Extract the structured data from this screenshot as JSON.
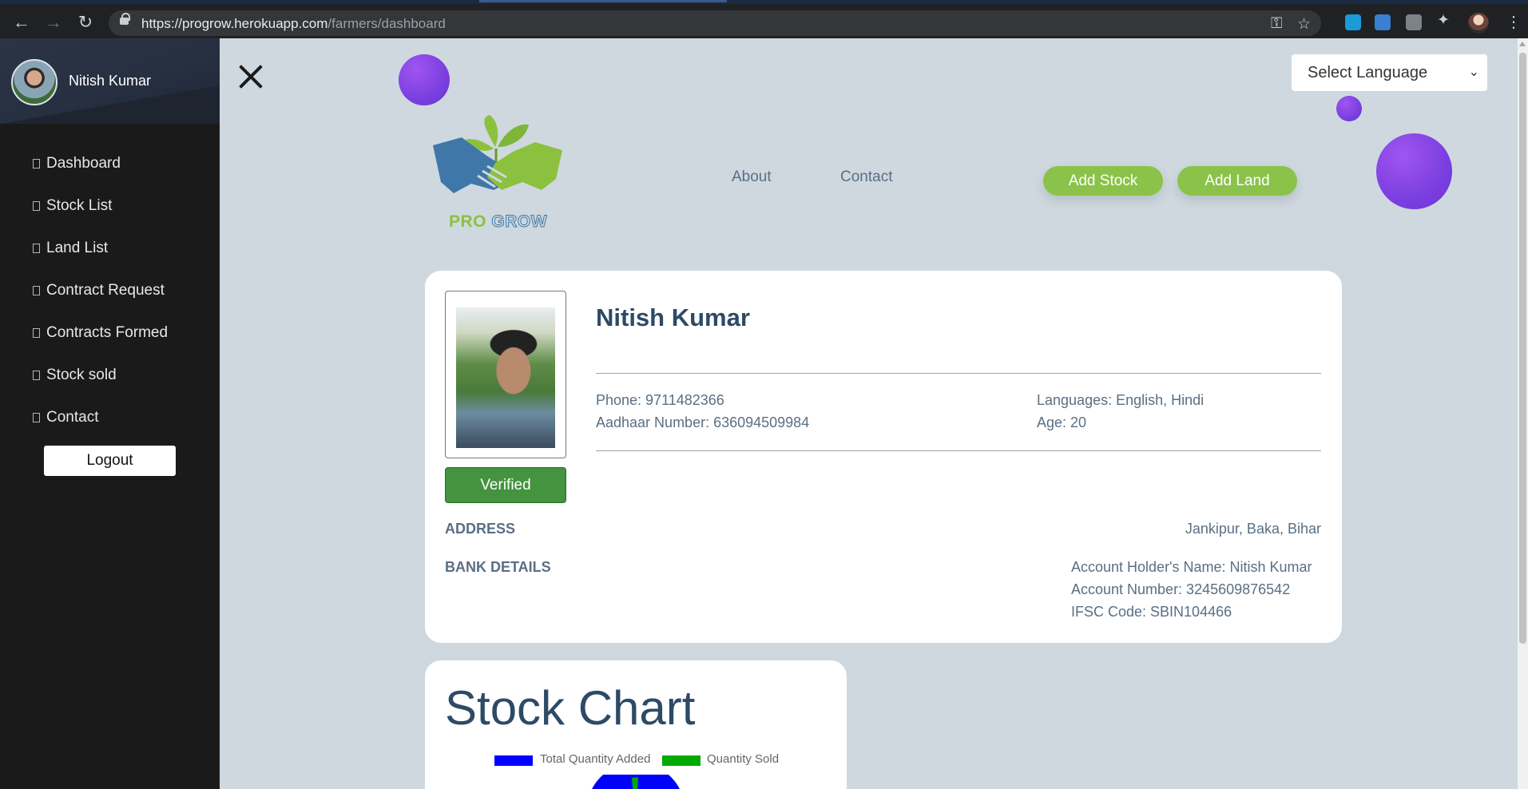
{
  "browser": {
    "url_domain": "https://progrow.herokuapp.com",
    "url_path": "/farmers/dashboard"
  },
  "sidebar": {
    "user_name": "Nitish Kumar",
    "items": [
      {
        "label": "Dashboard"
      },
      {
        "label": "Stock List"
      },
      {
        "label": "Land List"
      },
      {
        "label": "Contract Request"
      },
      {
        "label": "Contracts Formed"
      },
      {
        "label": "Stock sold"
      },
      {
        "label": "Contact"
      }
    ],
    "logout_label": "Logout"
  },
  "header": {
    "language_select": "Select Language",
    "logo_text_pro": "PRO",
    "logo_text_grow": "GROW",
    "nav": [
      {
        "label": "About"
      },
      {
        "label": "Contact"
      }
    ],
    "add_stock_label": "Add Stock",
    "add_land_label": "Add Land"
  },
  "profile": {
    "name": "Nitish Kumar",
    "verified_label": "Verified",
    "phone": "Phone: 9711482366",
    "aadhaar": "Aadhaar Number: 636094509984",
    "languages": "Languages: English, Hindi",
    "age": "Age: 20",
    "address_label": "ADDRESS",
    "address_value": "Jankipur, Baka, Bihar",
    "bank_label": "BANK DETAILS",
    "account_holder": "Account Holder's Name: Nitish Kumar",
    "account_number": "Account Number: 3245609876542",
    "ifsc": "IFSC Code: SBIN104466"
  },
  "stock_chart": {
    "title": "Stock Chart",
    "legend": [
      {
        "label": "Total Quantity Added",
        "color": "#0000ff"
      },
      {
        "label": "Quantity Sold",
        "color": "#00aa00"
      }
    ]
  },
  "colors": {
    "accent_green": "#8bc34a",
    "verified_green": "#43933f",
    "blob_purple": "#7b3fe0",
    "sidebar_bg": "#1a1a1a",
    "page_bg": "#cfd8df"
  }
}
